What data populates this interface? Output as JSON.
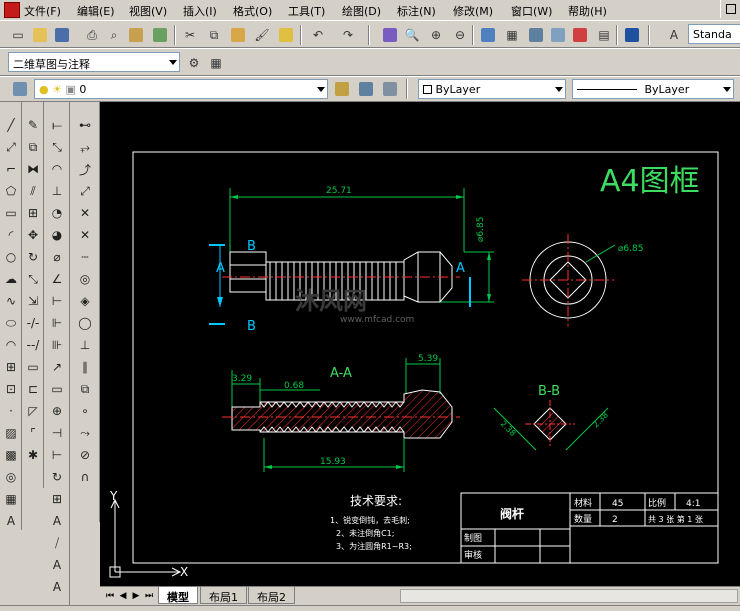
{
  "menubar": {
    "items": [
      "文件(F)",
      "编辑(E)",
      "视图(V)",
      "插入(I)",
      "格式(O)",
      "工具(T)",
      "绘图(D)",
      "标注(N)",
      "修改(M)",
      "窗口(W)",
      "帮助(H)"
    ]
  },
  "toolbar": {
    "text_style": "Standa"
  },
  "workspace": {
    "selected": "二维草图与注释"
  },
  "layer": {
    "current": "0"
  },
  "properties": {
    "color": "ByLayer",
    "linetype": "ByLayer"
  },
  "drawing": {
    "frame_title": "A4图框",
    "dims": {
      "overall_length": "25.71",
      "height": "⌀6.85",
      "circle_dia": "⌀6.85",
      "thread_start": "3.29",
      "groove": "0.68",
      "head_len": "5.39",
      "thread_len": "15.93",
      "bb_dim1": "2.38",
      "bb_dim2": "2.38"
    },
    "section_labels": {
      "a": "A",
      "b": "B",
      "section_aa": "A-A",
      "section_bb": "B-B"
    },
    "watermark": "沐风网",
    "watermark_url": "www.mfcad.com",
    "tech_requirements": {
      "heading": "技术要求:",
      "items": [
        "1、锐变倒钝，去毛刺;",
        "2、未注倒角C1;",
        "3、为注圆角R1~R3;"
      ]
    },
    "title_block": {
      "part_name": "阀杆",
      "material_label": "材料",
      "material_value": "45",
      "scale_label": "比例",
      "scale_value": "4:1",
      "quantity_label": "数量",
      "quantity_value": "2",
      "sheets": "共 3 张  第 1 张",
      "drawn_label": "制图",
      "checked_label": "审核"
    },
    "axis_x": "X",
    "axis_y": "Y"
  },
  "tabs": [
    "模型",
    "布局1",
    "布局2"
  ],
  "colors": {
    "dim_green": "#00c84a",
    "cyan": "#00c8ff",
    "hatch_red": "#ff3030",
    "text_green": "#3cdc60"
  }
}
